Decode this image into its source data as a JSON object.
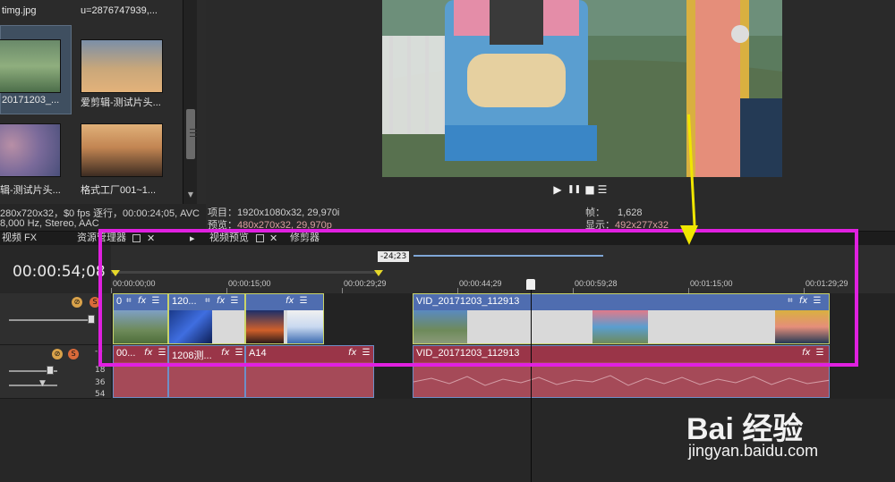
{
  "media_browser": {
    "items": [
      {
        "label": "timg.jpg"
      },
      {
        "label": "u=2876747939,..."
      },
      {
        "label": "20171203_..."
      },
      {
        "label": "爱剪辑-测试片头..."
      },
      {
        "label": "辑-测试片头..."
      },
      {
        "label": "格式工厂001~1..."
      }
    ],
    "icons": {
      "scroll_down": "▼"
    }
  },
  "media_info": {
    "line1": "280x720x32，$0 fps 逐行，00:00:24;05, AVC",
    "line2": "8,000 Hz, Stereo, AAC"
  },
  "preview": {
    "project_label": "项目：",
    "project_value": "1920x1080x32, 29,970i",
    "preview_label": "预览：",
    "preview_value": "480x270x32, 29,970p",
    "frame_label": "帧：",
    "frame_value": "1,628",
    "display_label": "显示：",
    "display_value": "492x277x32",
    "transport": {
      "play": "▶",
      "pause": "❚❚",
      "stop": "■",
      "menu": "☰"
    }
  },
  "tabs": {
    "video_fx": "视频 FX",
    "explorer": "资源管理器",
    "video_preview": "视频预览",
    "trimmer": "修剪器",
    "close": "✕",
    "expand": "▸"
  },
  "timeline": {
    "timecode": "00:00:54;08",
    "region_length": "-24;23",
    "ticks": [
      "00:00:00;00",
      "00:00:15;00",
      "00:00:29;29",
      "00:00:44;29",
      "00:00:59;28",
      "00:01:15;00",
      "00:01:29;29"
    ],
    "video_clips": [
      {
        "name": "0"
      },
      {
        "name": "120..."
      },
      {
        "name": ""
      },
      {
        "name": ""
      },
      {
        "name": "VID_20171203_112913"
      }
    ],
    "audio_clips": [
      {
        "name": "00..."
      },
      {
        "name": "1208测..."
      },
      {
        "name": "A14"
      },
      {
        "name": "VID_20171203_112913"
      }
    ],
    "db_labels": [
      "-5",
      "18",
      "36",
      "54"
    ],
    "clip_icons": {
      "crop": "⌗",
      "fx": "fx",
      "menu": "☰"
    },
    "track_icons": {
      "mute": "⊘",
      "solo": "S"
    }
  },
  "watermark": {
    "brand": "Bai 经验",
    "url": "jingyan.baidu.com"
  },
  "colors": {
    "highlight": "#e020e0",
    "arrow": "#f0e600",
    "video_clip": "#4f6db0",
    "audio_clip": "#9a3548"
  }
}
